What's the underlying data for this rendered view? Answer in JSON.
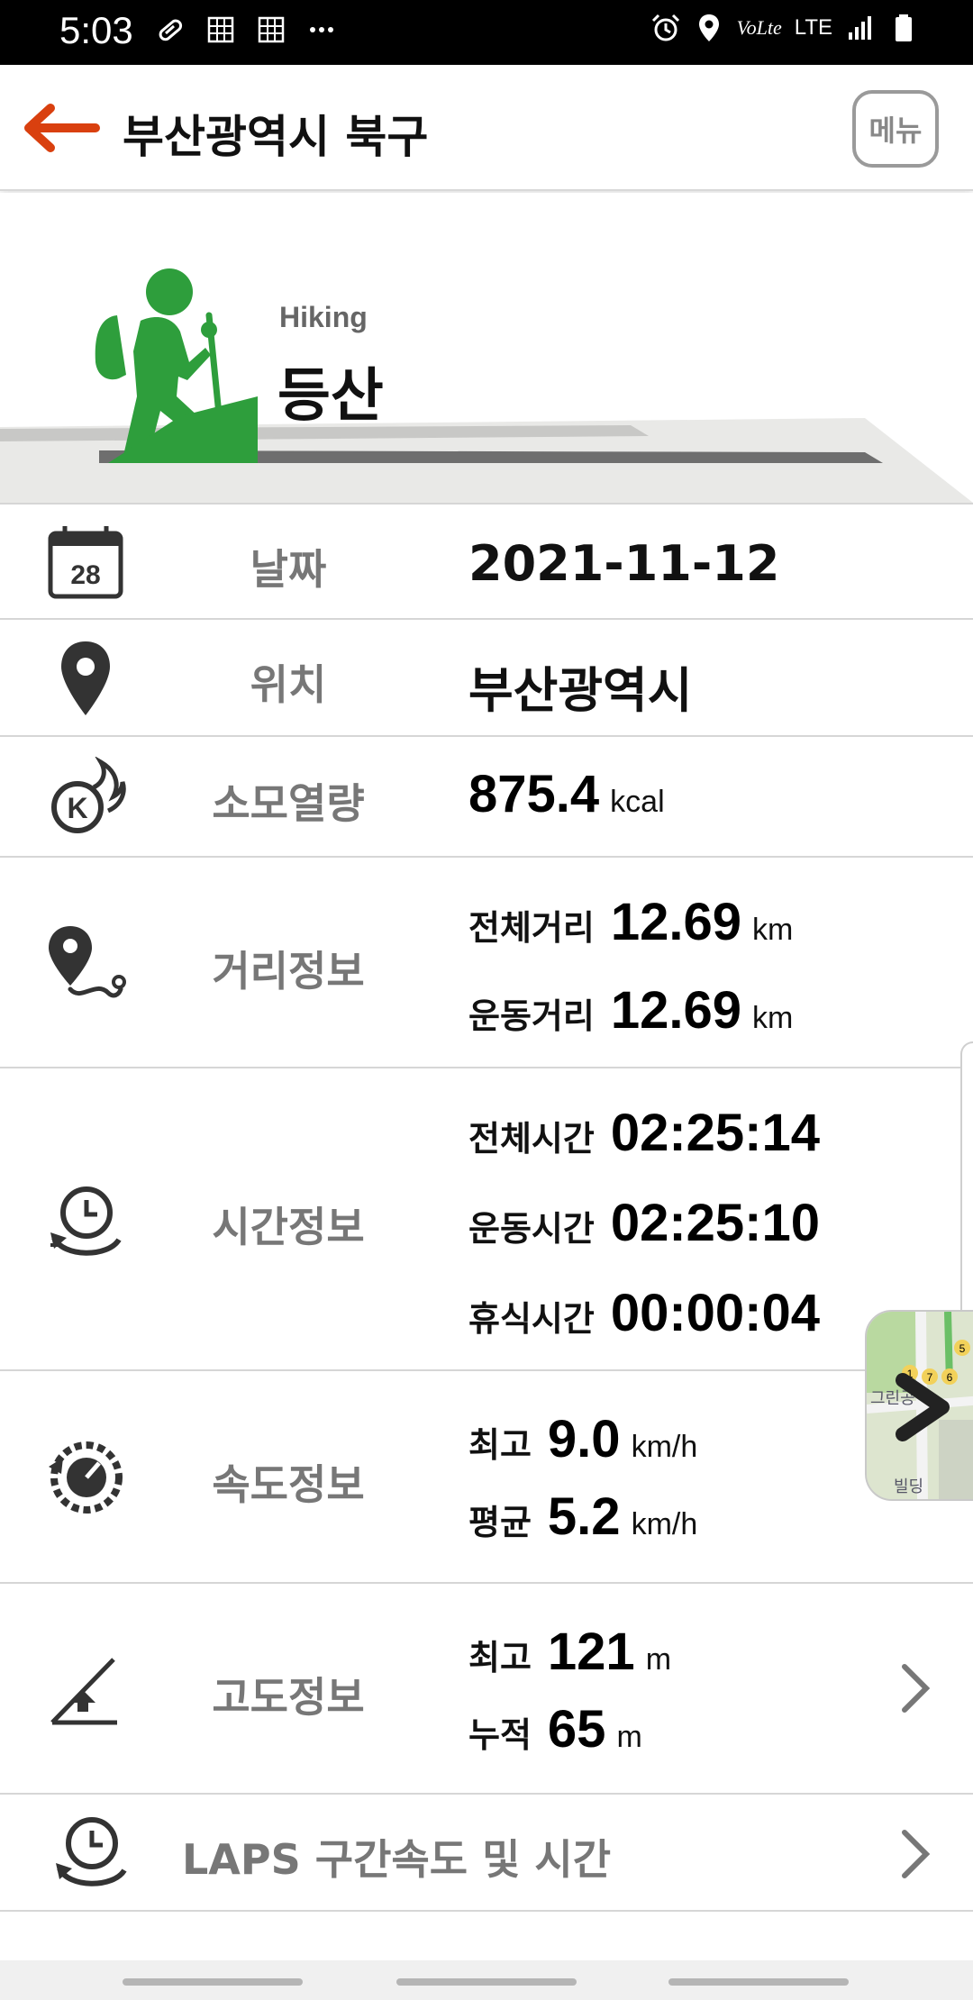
{
  "status_bar": {
    "time": "5:03",
    "lte_label": "LTE",
    "volte_label": "VoLte"
  },
  "header": {
    "title": "부산광역시 북구",
    "menu_label": "메뉴"
  },
  "activity": {
    "english": "Hiking",
    "korean": "등산"
  },
  "rows": {
    "date": {
      "label": "날짜",
      "value": "2021-11-12",
      "icon_day": "28"
    },
    "location": {
      "label": "위치",
      "value": "부산광역시"
    },
    "calories": {
      "label": "소모열량",
      "value": "875.4",
      "unit": "kcal",
      "icon_letter": "K"
    },
    "distance": {
      "label": "거리정보",
      "items": [
        {
          "key": "전체거리",
          "value": "12.69",
          "unit": "km"
        },
        {
          "key": "운동거리",
          "value": "12.69",
          "unit": "km"
        }
      ]
    },
    "time": {
      "label": "시간정보",
      "items": [
        {
          "key": "전체시간",
          "value": "02:25:14"
        },
        {
          "key": "운동시간",
          "value": "02:25:10"
        },
        {
          "key": "휴식시간",
          "value": "00:00:04"
        }
      ]
    },
    "speed": {
      "label": "속도정보",
      "items": [
        {
          "key": "최고",
          "value": "9.0",
          "unit": "km/h"
        },
        {
          "key": "평균",
          "value": "5.2",
          "unit": "km/h"
        }
      ]
    },
    "altitude": {
      "label": "고도정보",
      "items": [
        {
          "key": "최고",
          "value": "121",
          "unit": "m"
        },
        {
          "key": "누적",
          "value": "65",
          "unit": "m"
        }
      ]
    },
    "laps": {
      "label": "LAPS 구간속도 및 시간"
    }
  },
  "map_thumb": {
    "numbers": [
      "1",
      "7",
      "6",
      "5"
    ],
    "text_top": "그린공",
    "text_bottom": "빌딩"
  },
  "colors": {
    "accent_red": "#d9400f",
    "hiker_green": "#2e9e3c",
    "label_gray": "#777777"
  },
  "icons": [
    "back-arrow-icon",
    "calendar-icon",
    "location-pin-icon",
    "calorie-flame-icon",
    "route-pin-icon",
    "clock-icon",
    "speedometer-icon",
    "altitude-icon",
    "chevron-right-icon"
  ]
}
